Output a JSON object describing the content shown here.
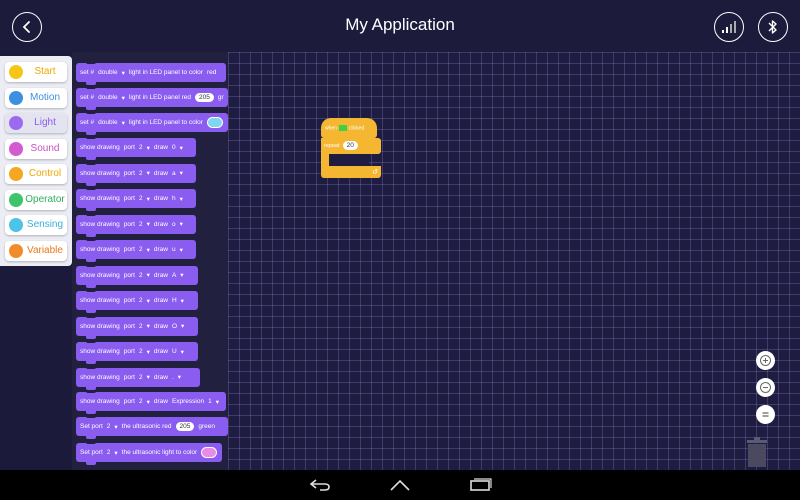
{
  "header": {
    "title": "My Application"
  },
  "categories": [
    {
      "label": "Start",
      "color": "#f5c518",
      "text_color": "#f0a500"
    },
    {
      "label": "Motion",
      "color": "#3d8fe0",
      "text_color": "#3d8fe0"
    },
    {
      "label": "Light",
      "color": "#9b6af0",
      "text_color": "#8a5cf0"
    },
    {
      "label": "Sound",
      "color": "#d45ad0",
      "text_color": "#c94fc4"
    },
    {
      "label": "Control",
      "color": "#f5a623",
      "text_color": "#f0a500"
    },
    {
      "label": "Operator",
      "color": "#3ec46d",
      "text_color": "#2fae5a"
    },
    {
      "label": "Sensing",
      "color": "#4cc3e8",
      "text_color": "#3ab0d8"
    },
    {
      "label": "Variable",
      "color": "#f08c2a",
      "text_color": "#e8781a"
    }
  ],
  "palette": {
    "set_led_color": {
      "prefix": "set #",
      "mode": "double",
      "mid": "light in LED panel to color",
      "value": "red"
    },
    "set_led_rgb": {
      "prefix": "set #",
      "mode": "double",
      "mid": "light in LED panel red",
      "red": "205",
      "tail": "gr"
    },
    "set_led_swatch": {
      "prefix": "set #",
      "mode": "double",
      "mid": "light in LED panel to color",
      "swatch_color": "#7ed6f0"
    },
    "show_drawing": {
      "label": "show drawing",
      "port_label": "port",
      "port": "2",
      "draw_label": "draw",
      "values": [
        "0",
        "a",
        "h",
        "o",
        "u",
        "A",
        "H",
        "O",
        "U",
        "."
      ],
      "expression": "Expression",
      "expression_value": "1"
    },
    "ultra_rgb": {
      "prefix": "Set port",
      "port": "2",
      "mid": "the ultrasonic red",
      "red": "205",
      "tail": "green"
    },
    "ultra_color": {
      "prefix": "Set port",
      "port": "2",
      "mid": "the ultrasonic light to color",
      "swatch_color": "#e88be6"
    }
  },
  "script": {
    "hat_label": "when",
    "hat_event": "clicked",
    "repeat_label": "repeat",
    "repeat_value": "20"
  }
}
